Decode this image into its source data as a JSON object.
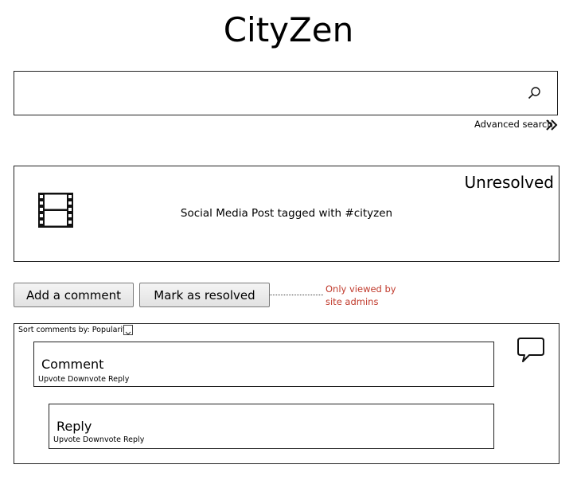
{
  "app": {
    "title": "CityZen"
  },
  "search": {
    "value": "",
    "placeholder": "",
    "advanced_label": "Advanced search"
  },
  "post": {
    "status": "Unresolved",
    "text": "Social Media Post tagged with #cityzen",
    "media_icon": "film-icon"
  },
  "actions": {
    "add_comment": "Add a comment",
    "mark_resolved": "Mark as resolved",
    "admin_note": "Only viewed by site admins",
    "admin_note_color": "#c0392b"
  },
  "comments": {
    "sort_label": "Sort comments by: Popularity",
    "bubble_icon": "speech-bubble-icon",
    "items": [
      {
        "title": "Comment",
        "upvote": "Upvote",
        "downvote": "Downvote",
        "reply": "Reply"
      },
      {
        "title": "Reply",
        "upvote": "Upvote",
        "downvote": "Downvote",
        "reply": "Reply"
      }
    ]
  }
}
